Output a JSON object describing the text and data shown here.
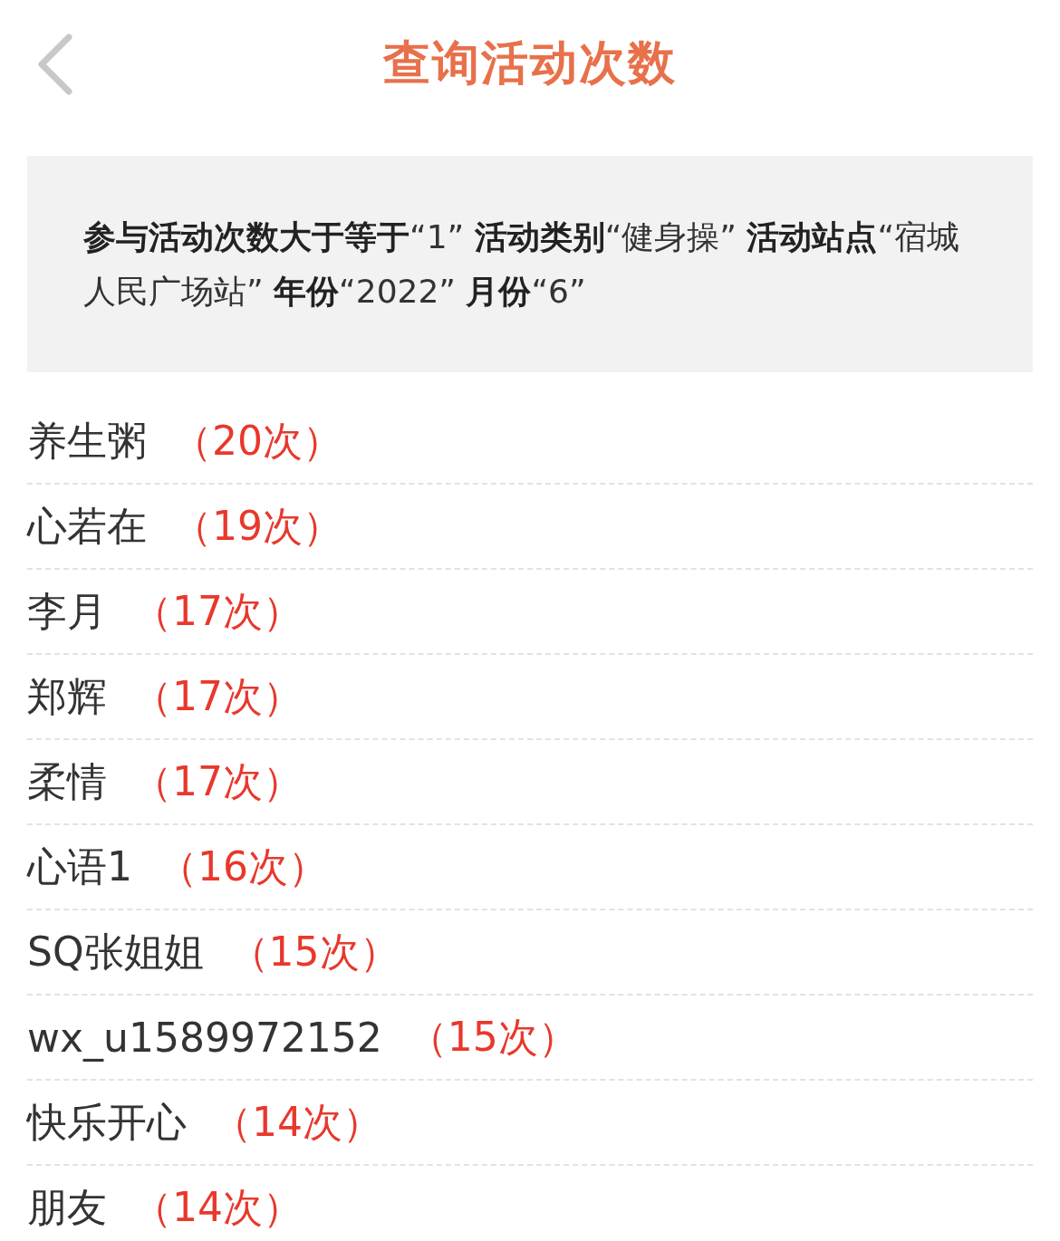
{
  "header": {
    "title": "查询活动次数"
  },
  "filter": {
    "summary": "**参与活动次数大于等于**“1” **活动类别**“健身操” **活动站点**“宿城人民广场站” **年份**“2022” **月份**“6”"
  },
  "results": [
    {
      "name": "养生粥",
      "count": "（20次）"
    },
    {
      "name": "心若在",
      "count": "（19次）"
    },
    {
      "name": "李月",
      "count": "（17次）"
    },
    {
      "name": "郑辉",
      "count": "（17次）"
    },
    {
      "name": "柔情",
      "count": "（17次）"
    },
    {
      "name": "心语1",
      "count": "（16次）"
    },
    {
      "name": "SQ张姐姐",
      "count": "（15次）"
    },
    {
      "name": "wx_u1589972152",
      "count": "（15次）"
    },
    {
      "name": "快乐开心",
      "count": "（14次）"
    },
    {
      "name": "朋友",
      "count": "（14次）"
    }
  ]
}
